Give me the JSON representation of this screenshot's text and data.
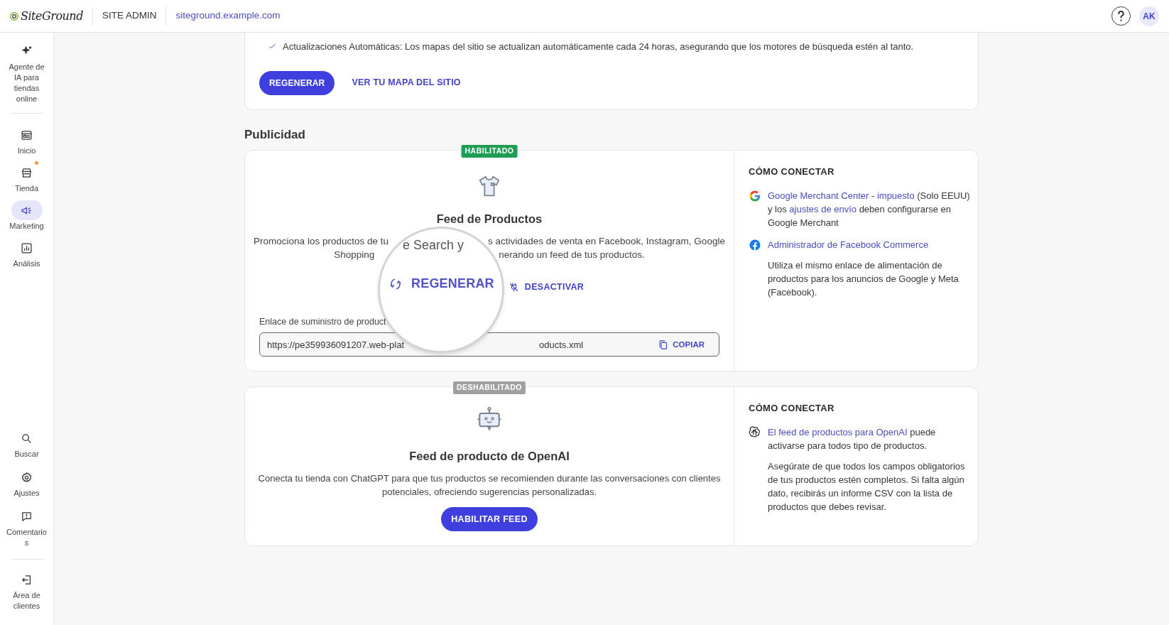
{
  "header": {
    "logo": "SiteGround",
    "section": "SITE ADMIN",
    "domain": "siteground.example.com",
    "avatar": "AK"
  },
  "sidebar": {
    "top_items": [
      {
        "label": "Agente de IA para tiendas online",
        "selected": false,
        "notification": false
      },
      {
        "label": "Inicio",
        "selected": false,
        "notification": false
      },
      {
        "label": "Tienda",
        "selected": false,
        "notification": true
      },
      {
        "label": "Marketing",
        "selected": true,
        "notification": false
      },
      {
        "label": "Análisis",
        "selected": false,
        "notification": false
      }
    ],
    "bottom_items": [
      {
        "label": "Buscar",
        "selected": false,
        "notification": false
      },
      {
        "label": "Ajustes",
        "selected": false,
        "notification": false
      },
      {
        "label": "Comentarios",
        "selected": false,
        "notification": false
      },
      {
        "label": "Área de clientes",
        "selected": false,
        "notification": false
      }
    ]
  },
  "sitemap_card": {
    "check_text": "Actualizaciones Automáticas: Los mapas del sitio se actualizan automáticamente cada 24 horas, asegurando que los motores de búsqueda estén al tanto.",
    "primary_button": "REGENERAR",
    "link": "VER TU MAPA DEL SITIO"
  },
  "section_title": "Publicidad",
  "feeds": [
    {
      "kind": "product_feed",
      "status": "HABILITADO",
      "enabled": true,
      "title": "Feed de Productos",
      "description_lines": [
        [
          "Promociona los productos de tu",
          "s actividades de venta en Facebook, Instagram, Google"
        ],
        [
          "Shopping",
          "nerando un feed de tus productos."
        ]
      ],
      "magnifier": {
        "text": "e Search y",
        "button": "REGENERAR"
      },
      "secondary_button": "DESACTIVAR",
      "field_label": "Enlace de suministro de product",
      "url_parts": [
        "https://pe359936091207.web-plat",
        "oducts.xml"
      ],
      "copy_button": "COPIAR",
      "connect": {
        "heading": "CÓMO CONECTAR",
        "entries": [
          {
            "segments": [
              {
                "text": "Google Merchant Center",
                "link": true
              },
              {
                "text": " - ",
                "link": false
              },
              {
                "text": "impuesto",
                "link": true
              },
              {
                "text": " (Solo EEUU) y los ",
                "link": false
              },
              {
                "text": "ajustes de envío",
                "link": true
              },
              {
                "text": " deben configurarse en Google Merchant",
                "link": false
              }
            ]
          },
          {
            "segments": [
              {
                "text": "Administrador de Facebook Commerce",
                "link": true
              }
            ],
            "note": "Utiliza el mismo enlace de alimentación de productos para los anuncios de Google y Meta (Facebook)."
          }
        ]
      }
    },
    {
      "kind": "openai_feed",
      "status": "DESHABILITADO",
      "enabled": false,
      "title": "Feed de producto de OpenAI",
      "description": "Conecta tu tienda con ChatGPT para que tus productos se recomienden durante las conversaciones con clientes potenciales, ofreciendo sugerencias personalizadas.",
      "primary_button": "HABILITAR FEED",
      "connect": {
        "heading": "CÓMO CONECTAR",
        "entries": [
          {
            "segments": [
              {
                "text": "El feed de productos para OpenAI",
                "link": true
              },
              {
                "text": " puede activarse para todos tipo de productos.",
                "link": false
              }
            ],
            "note": "Asegúrate de que todos los campos obligatorios de tus productos estén completos. Si falta algún dato, recibirás un informe CSV con la lista de productos que debes revisar."
          }
        ]
      }
    }
  ]
}
